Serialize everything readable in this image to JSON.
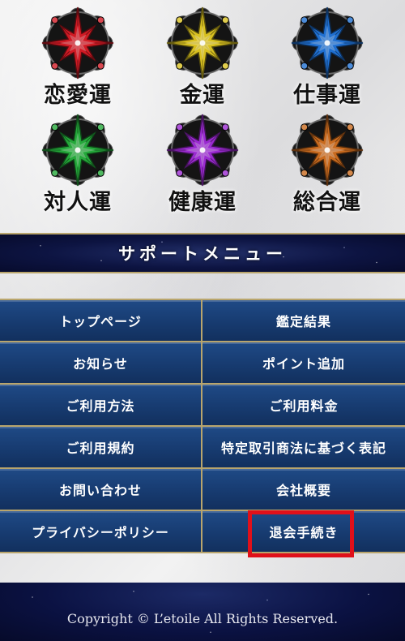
{
  "fortunes": [
    {
      "label": "恋愛運",
      "color": "#d01a24"
    },
    {
      "label": "金運",
      "color": "#d8c020"
    },
    {
      "label": "仕事運",
      "color": "#1f6fd0"
    },
    {
      "label": "対人運",
      "color": "#24a83a"
    },
    {
      "label": "健康運",
      "color": "#9a2ad0"
    },
    {
      "label": "総合運",
      "color": "#c86a1e"
    }
  ],
  "support": {
    "title": "サポートメニュー"
  },
  "menu": [
    {
      "label": "トップページ"
    },
    {
      "label": "鑑定結果"
    },
    {
      "label": "お知らせ"
    },
    {
      "label": "ポイント追加"
    },
    {
      "label": "ご利用方法"
    },
    {
      "label": "ご利用料金"
    },
    {
      "label": "ご利用規約"
    },
    {
      "label": "特定取引商法に基づく表記"
    },
    {
      "label": "お問い合わせ"
    },
    {
      "label": "会社概要"
    },
    {
      "label": "プライバシーポリシー"
    },
    {
      "label": "退会手続き"
    }
  ],
  "highlight_color": "#e0101a",
  "footer": {
    "copyright": "Copyright © L’etoile All Rights Reserved."
  }
}
